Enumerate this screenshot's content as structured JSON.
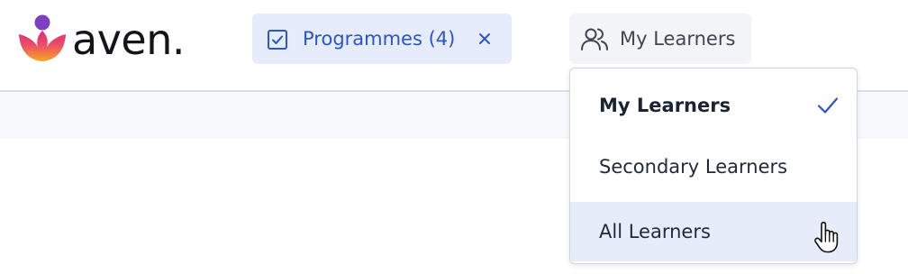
{
  "app": {
    "logo_text": "aven."
  },
  "filters": {
    "programmes_chip": {
      "label": "Programmes (4)",
      "icon": "checkbox-checked-icon",
      "remove_icon": "close-icon"
    },
    "learner_scope": {
      "label": "My Learners",
      "icon": "people-icon",
      "options": [
        {
          "label": "My Learners",
          "selected": true
        },
        {
          "label": "Secondary Learners",
          "selected": false
        },
        {
          "label": "All Learners",
          "selected": false,
          "hovered": true
        }
      ]
    }
  },
  "colors": {
    "accent": "#2a56c6",
    "chip_bg": "#e6ecfb",
    "hover_bg": "#e6ecfa",
    "logo_gradient": [
      "#f6a623",
      "#e8357a",
      "#7b3fbf"
    ]
  }
}
